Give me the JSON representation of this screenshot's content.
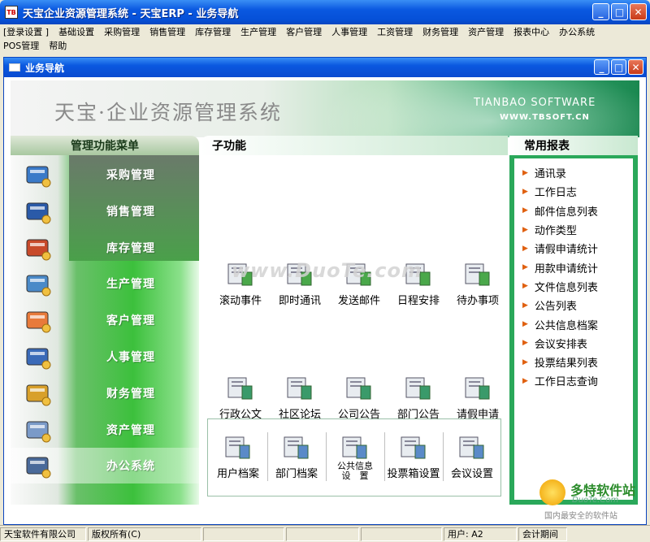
{
  "window": {
    "title": "天宝企业资源管理系统 - 天宝ERP - 业务导航",
    "icon_text": "TB"
  },
  "menu": {
    "row1": [
      "[登录设置 ]",
      "基础设置",
      "采购管理",
      "销售管理",
      "库存管理",
      "生产管理",
      "客户管理",
      "人事管理",
      "工资管理",
      "财务管理",
      "资产管理",
      "报表中心",
      "办公系统"
    ],
    "row2": [
      "POS管理",
      "帮助"
    ]
  },
  "child": {
    "title": "业务导航"
  },
  "banner": {
    "title": "天宝·企业资源管理系统",
    "en": "TIANBAO SOFTWARE",
    "url": "WWW.TBSOFT.CN"
  },
  "left": {
    "header": "管理功能菜单",
    "items": [
      "采购管理",
      "销售管理",
      "库存管理",
      "生产管理",
      "客户管理",
      "人事管理",
      "财务管理",
      "资产管理",
      "办公系统"
    ]
  },
  "mid": {
    "header": "子功能",
    "row1": [
      "滚动事件",
      "即时通讯",
      "发送邮件",
      "日程安排",
      "待办事项"
    ],
    "row2": [
      "行政公文",
      "社区论坛",
      "公司公告",
      "部门公告",
      "请假申请"
    ],
    "row3": [
      "用户档案",
      "部门档案",
      "公共信息",
      "设　置",
      "投票箱设置",
      "会议设置"
    ]
  },
  "right": {
    "header": "常用报表",
    "items": [
      "通讯录",
      "工作日志",
      "邮件信息列表",
      "动作类型",
      "请假申请统计",
      "用款申请统计",
      "文件信息列表",
      "公告列表",
      "公共信息档案",
      "会议安排表",
      "投票结果列表",
      "工作日志查询"
    ]
  },
  "watermark": "www.DuoTe.com",
  "logo": {
    "brand": "多特软件站",
    "domain": "DuoTe.Com",
    "tagline": "国内最安全的软件站"
  },
  "status": {
    "company": "天宝软件有限公司",
    "copyright": "版权所有(C)",
    "user": "用户: A2",
    "period": "会计期间"
  },
  "colors": {
    "accent": "#0a58e0",
    "green": "#2aa85a"
  }
}
